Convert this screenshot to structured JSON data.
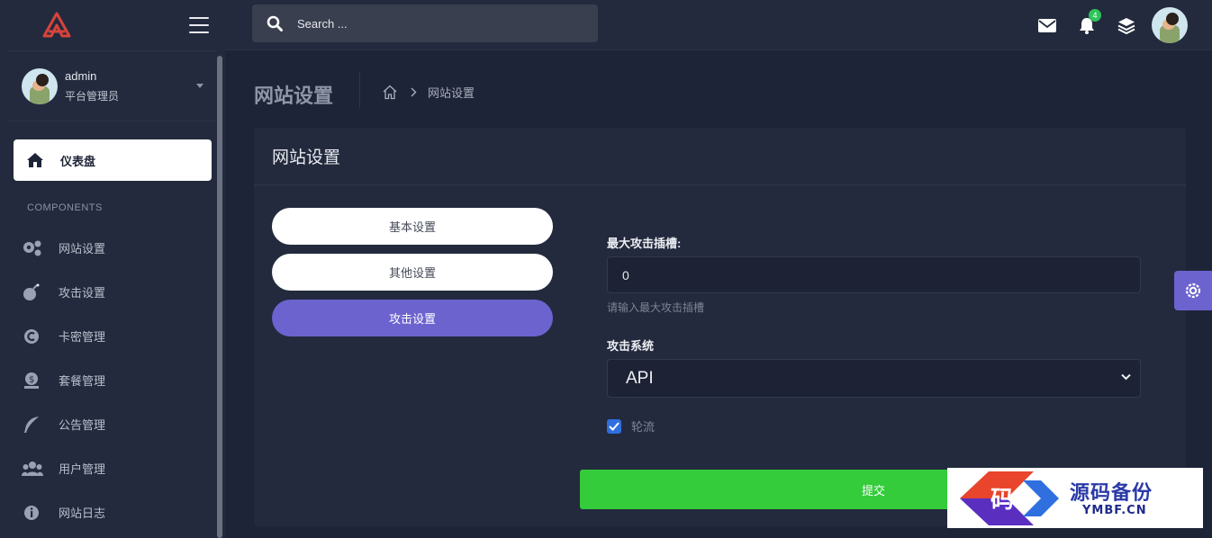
{
  "topbar": {
    "search_placeholder": "Search ...",
    "notification_count": "4"
  },
  "sidebar": {
    "user": {
      "name": "admin",
      "role": "平台管理员"
    },
    "dashboard_label": "仪表盘",
    "section_title": "COMPONENTS",
    "items": [
      {
        "label": "网站设置",
        "icon": "gears-icon"
      },
      {
        "label": "攻击设置",
        "icon": "bomb-icon"
      },
      {
        "label": "卡密管理",
        "icon": "copyright-icon"
      },
      {
        "label": "套餐管理",
        "icon": "money-icon"
      },
      {
        "label": "公告管理",
        "icon": "feather-icon"
      },
      {
        "label": "用户管理",
        "icon": "users-icon"
      },
      {
        "label": "网站日志",
        "icon": "info-icon"
      }
    ]
  },
  "page": {
    "title": "网站设置",
    "breadcrumb": "网站设置"
  },
  "card": {
    "title": "网站设置",
    "tabs": [
      {
        "label": "基本设置",
        "active": false
      },
      {
        "label": "其他设置",
        "active": false
      },
      {
        "label": "攻击设置",
        "active": true
      }
    ],
    "max_slots_label": "最大攻击插槽:",
    "max_slots_value": "0",
    "max_slots_help": "请输入最大攻击插槽",
    "system_label": "攻击系统",
    "system_selected": "API",
    "rotate_label": "轮流",
    "rotate_checked": true,
    "submit_label": "提交"
  },
  "watermark": {
    "glyph": "码",
    "text": "源码备份",
    "sub": "YMBF.CN"
  },
  "colors": {
    "accent": "#6c63cf",
    "submit": "#34cc3a",
    "badge": "#2ec35a",
    "background": "#1e2437",
    "panel": "#232a3d"
  }
}
